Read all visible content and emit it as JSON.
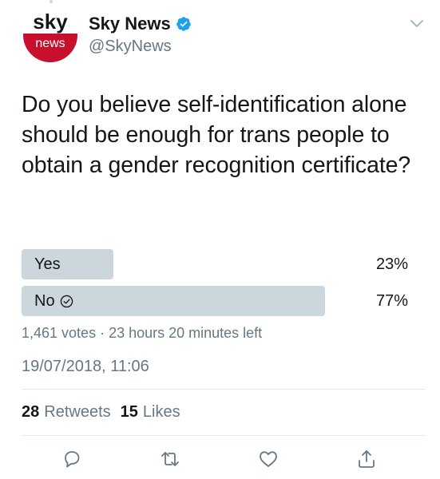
{
  "account": {
    "avatar_top_text": "sky",
    "avatar_bottom_text": "news",
    "display_name": "Sky News",
    "handle": "@SkyNews",
    "verified": true
  },
  "tweet": {
    "text": "Do you believe self-identification alone should be enough for trans people to obtain a gender recognition certificate?"
  },
  "poll": {
    "options": [
      {
        "label": "Yes",
        "percent_text": "23%",
        "percent": 23,
        "selected": false
      },
      {
        "label": "No",
        "percent_text": "77%",
        "percent": 77,
        "selected": true
      }
    ],
    "meta": "1,461 votes · 23 hours 20 minutes left"
  },
  "timestamp": "19/07/2018, 11:06",
  "stats": {
    "retweets_count": "28",
    "retweets_label": "Retweets",
    "likes_count": "15",
    "likes_label": "Likes"
  },
  "actions": [
    "reply-icon",
    "retweet-icon",
    "like-icon",
    "share-icon"
  ],
  "colors": {
    "bar": "#ccd6dd",
    "secondary_text": "#657786",
    "verified_blue": "#1da1f2",
    "brand_red": "#c8102e"
  }
}
